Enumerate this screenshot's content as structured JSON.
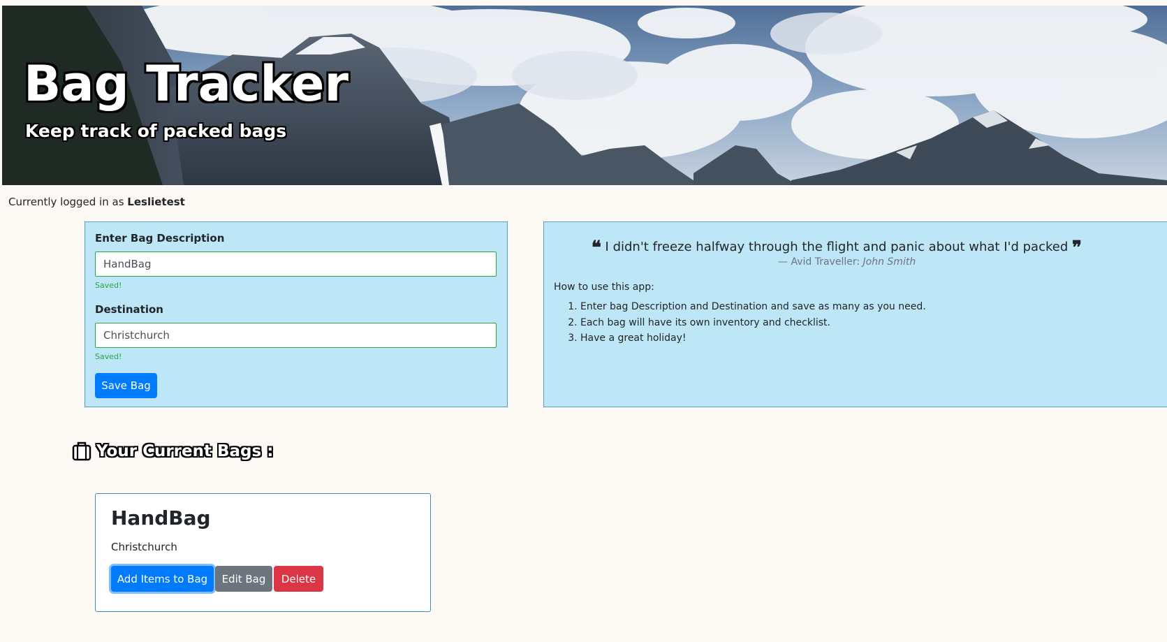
{
  "header": {
    "title": "Bag Tracker",
    "subtitle": "Keep track of packed bags"
  },
  "session": {
    "prefix": "Currently logged in as",
    "username": "Leslietest"
  },
  "bag_form": {
    "description_label": "Enter Bag Description",
    "description_value": "HandBag",
    "description_status": "Saved!",
    "destination_label": "Destination",
    "destination_value": "Christchurch",
    "destination_status": "Saved!",
    "save_label": "Save Bag"
  },
  "info": {
    "quote": "I didn't freeze halfway through the flight and panic about what I'd packed",
    "quote_author_prefix": "— Avid Traveller:",
    "quote_author": "John Smith",
    "howto_title": "How to use this app:",
    "steps": [
      "Enter bag Description and Destination and save as many as you need.",
      "Each bag will have its own inventory and checklist.",
      "Have a great holiday!"
    ]
  },
  "bags_section": {
    "heading": "Your Current Bags :",
    "icon": "suitcase-icon"
  },
  "bags": [
    {
      "title": "HandBag",
      "destination": "Christchurch",
      "add_items_label": "Add Items to Bag",
      "edit_label": "Edit Bag",
      "delete_label": "Delete"
    }
  ],
  "colors": {
    "panel_bg": "#bde6f7",
    "primary": "#007bff",
    "secondary": "#6c757d",
    "danger": "#dc3545",
    "success": "#28a745"
  }
}
